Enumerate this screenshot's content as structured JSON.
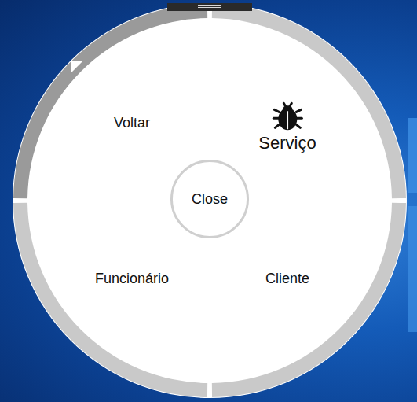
{
  "menu": {
    "close": "Close",
    "items": [
      {
        "label": "Serviço",
        "kind": "icon",
        "highlighted": false
      },
      {
        "label": "Cliente",
        "kind": "text",
        "highlighted": false
      },
      {
        "label": "Funcionário",
        "kind": "text",
        "highlighted": false
      },
      {
        "label": "Voltar",
        "kind": "text",
        "highlighted": true
      }
    ]
  }
}
